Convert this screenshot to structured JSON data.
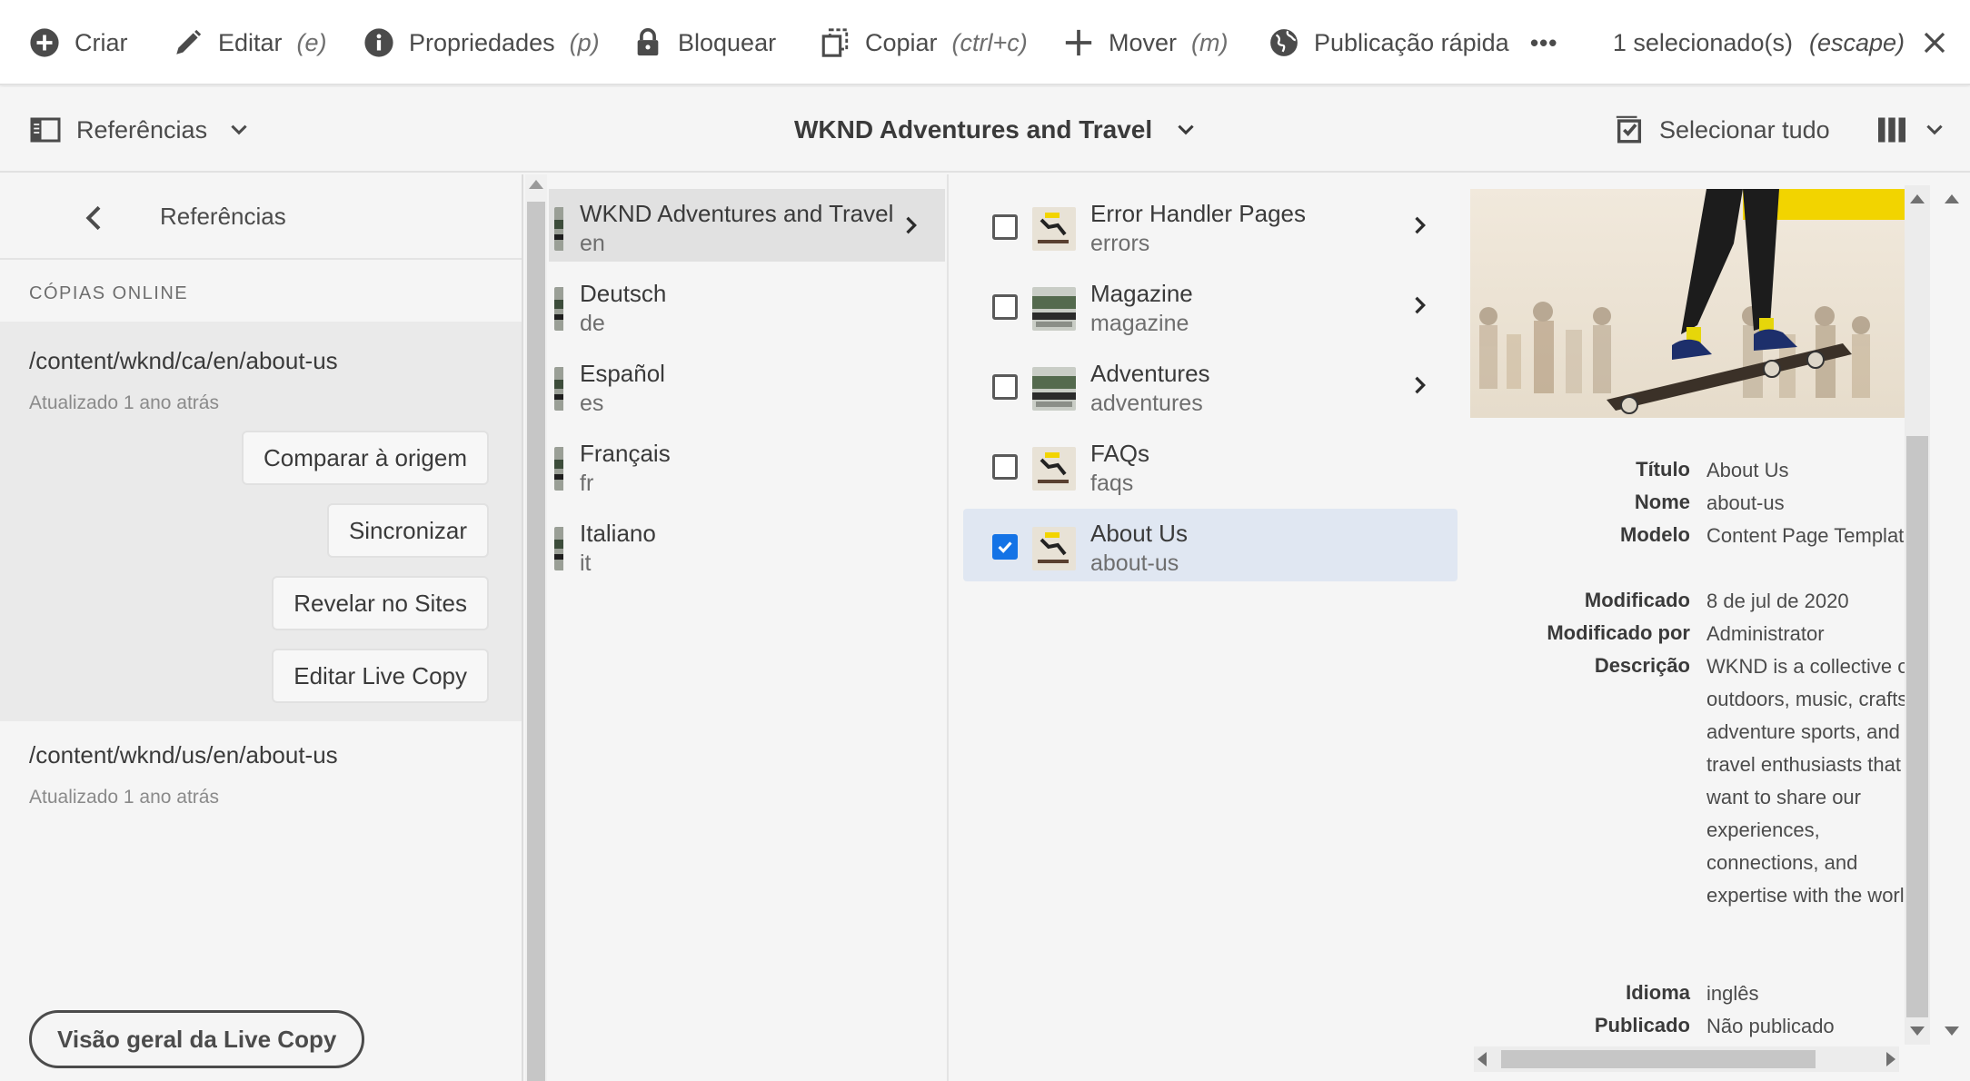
{
  "toolbar": {
    "create": {
      "label": "Criar"
    },
    "edit": {
      "label": "Editar",
      "shortcut": "(e)"
    },
    "properties": {
      "label": "Propriedades",
      "shortcut": "(p)"
    },
    "lock": {
      "label": "Bloquear"
    },
    "copy": {
      "label": "Copiar",
      "shortcut": "(ctrl+c)"
    },
    "move": {
      "label": "Mover",
      "shortcut": "(m)"
    },
    "quick_publish": {
      "label": "Publicação rápida"
    },
    "more": "•••",
    "selection_count": "1 selecionado(s)",
    "selection_escape": "(escape)"
  },
  "header": {
    "rail_toggle_label": "Referências",
    "title": "WKND Adventures and Travel",
    "select_all": "Selecionar tudo"
  },
  "rail": {
    "title": "Referências",
    "section": "Cópias online",
    "references": [
      {
        "path": "/content/wknd/ca/en/about-us",
        "updated": "Atualizado 1 ano atrás"
      },
      {
        "path": "/content/wknd/us/en/about-us",
        "updated": "Atualizado 1 ano atrás"
      }
    ],
    "actions": {
      "compare": "Comparar à origem",
      "sync": "Sincronizar",
      "reveal": "Revelar no Sites",
      "edit_live_copy": "Editar Live Copy"
    },
    "overview_button": "Visão geral da Live Copy"
  },
  "columns": {
    "languages": [
      {
        "title": "WKND Adventures and Travel",
        "name": "en"
      },
      {
        "title": "Deutsch",
        "name": "de"
      },
      {
        "title": "Español",
        "name": "es"
      },
      {
        "title": "Français",
        "name": "fr"
      },
      {
        "title": "Italiano",
        "name": "it"
      }
    ],
    "pages": [
      {
        "title": "Error Handler Pages",
        "name": "errors",
        "checked": false,
        "has_children": true
      },
      {
        "title": "Magazine",
        "name": "magazine",
        "checked": false,
        "has_children": true
      },
      {
        "title": "Adventures",
        "name": "adventures",
        "checked": false,
        "has_children": true
      },
      {
        "title": "FAQs",
        "name": "faqs",
        "checked": false,
        "has_children": false
      },
      {
        "title": "About Us",
        "name": "about-us",
        "checked": true,
        "has_children": false
      }
    ]
  },
  "properties": {
    "title_label": "Título",
    "title_value": "About Us",
    "name_label": "Nome",
    "name_value": "about-us",
    "template_label": "Modelo",
    "template_value": "Content Page Template",
    "modified_label": "Modificado",
    "modified_value": "8 de jul de 2020",
    "modified_by_label": "Modificado por",
    "modified_by_value": "Administrator",
    "description_label": "Descrição",
    "description_value": "WKND is a collective of outdoors, music, crafts, adventure sports, and travel enthusiasts that want to share our experiences, connections, and expertise with the world.",
    "language_label": "Idioma",
    "language_value": "inglês",
    "published_label": "Publicado",
    "published_value": "Não publicado"
  },
  "colors": {
    "accent": "#1473e6",
    "selected_row": "#e0e7f2",
    "highlight_row": "#e1e1e1"
  }
}
